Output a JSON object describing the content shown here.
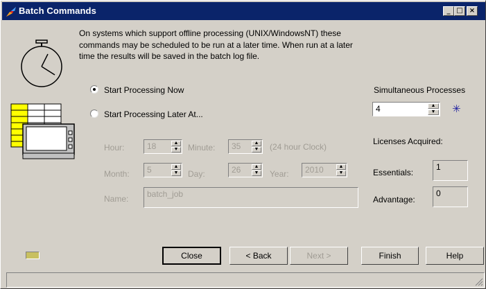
{
  "window": {
    "title": "Batch Commands"
  },
  "description": {
    "line1": "On systems which support offline processing (UNIX/WindowsNT) these",
    "line2": "commands may be scheduled to be run at a later time. When run at a later",
    "line3": "time the results will be saved in the batch log file."
  },
  "options": {
    "now_label": "Start Processing Now",
    "later_label": "Start Processing Later At..."
  },
  "schedule": {
    "hour_label": "Hour:",
    "hour_value": "18",
    "minute_label": "Minute:",
    "minute_value": "35",
    "clock_note": "(24 hour Clock)",
    "month_label": "Month:",
    "month_value": "5",
    "day_label": "Day:",
    "day_value": "26",
    "year_label": "Year:",
    "year_value": "2010",
    "name_label": "Name:",
    "name_value": "batch_job"
  },
  "processes": {
    "label": "Simultaneous Processes",
    "value": "4",
    "asterisk": "✳"
  },
  "licenses": {
    "label": "Licenses Acquired:",
    "essentials_label": "Essentials:",
    "essentials_value": "1",
    "advantage_label": "Advantage:",
    "advantage_value": "0"
  },
  "buttons": {
    "close": "Close",
    "back": "< Back",
    "next": "Next >",
    "finish": "Finish",
    "help": "Help"
  },
  "titlebar_buttons": {
    "minimize": "_",
    "maximize": "□",
    "close": "×"
  },
  "icons": [
    "app-icon",
    "stopwatch-icon",
    "scheduled-computer-icon",
    "status-led-icon"
  ]
}
